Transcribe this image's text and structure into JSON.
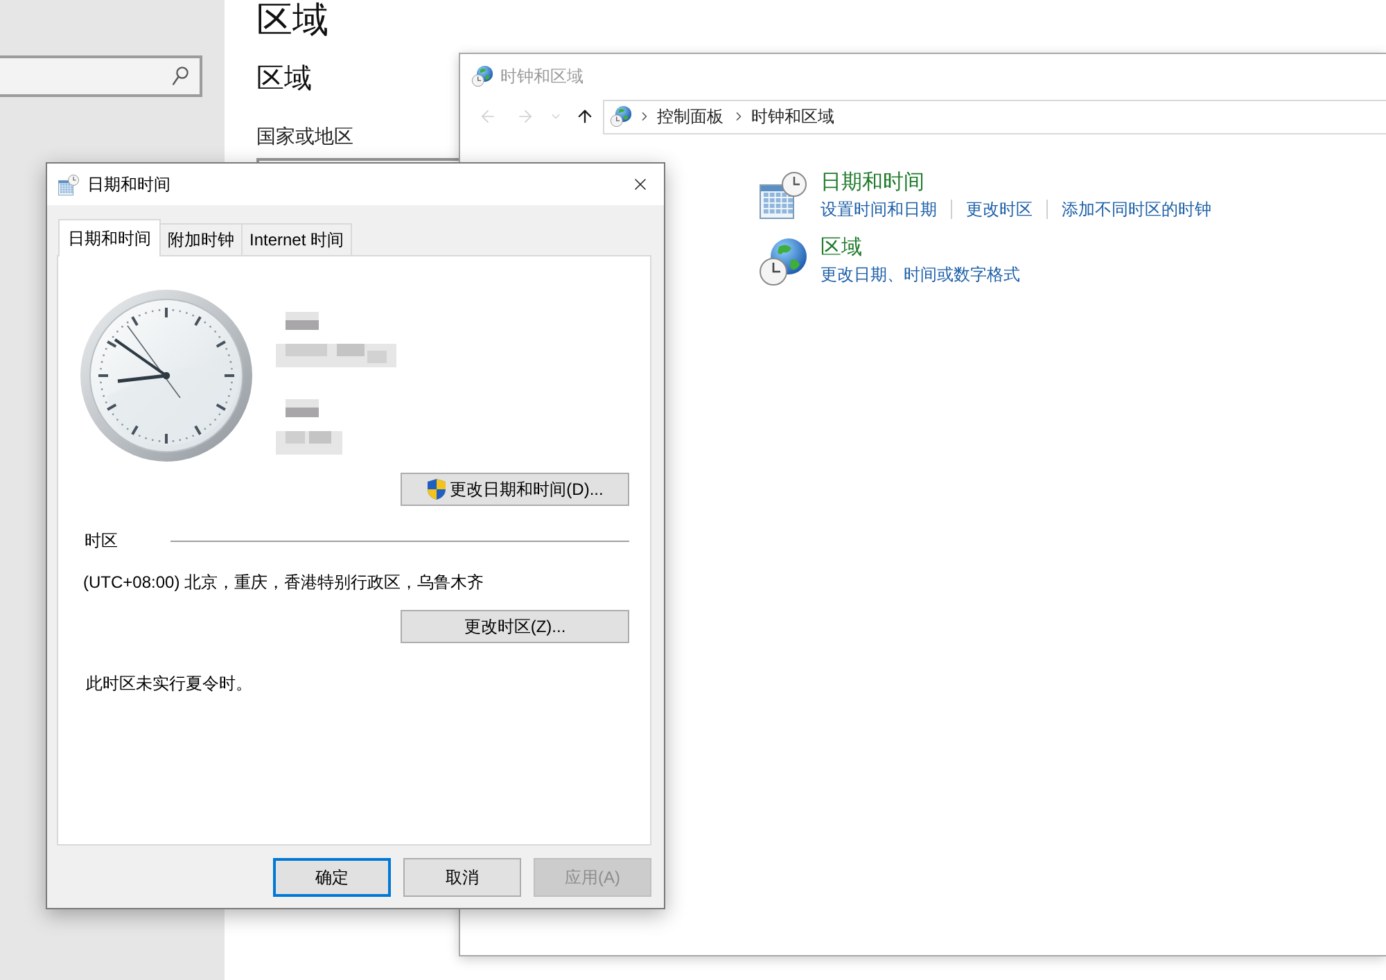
{
  "settings": {
    "page_heading": "区域",
    "section_title": "区域",
    "field_label": "国家或地区"
  },
  "control_panel": {
    "title": "时钟和区域",
    "nav_buttons": [
      {
        "kind": "back",
        "disabled": true
      },
      {
        "kind": "forward",
        "disabled": true
      },
      {
        "kind": "recent",
        "disabled": true
      },
      {
        "kind": "up",
        "disabled": false
      }
    ],
    "breadcrumb": [
      "控制面板",
      "时钟和区域"
    ],
    "categories": [
      {
        "kind": "datetime",
        "title": "日期和时间",
        "links": [
          "设置时间和日期",
          "更改时区",
          "添加不同时区的时钟"
        ]
      },
      {
        "kind": "region",
        "title": "区域",
        "links": [
          "更改日期、时间或数字格式"
        ]
      }
    ]
  },
  "dialog": {
    "title": "日期和时间",
    "tabs": [
      {
        "label": "日期和时间",
        "selected": true
      },
      {
        "label": "附加时钟",
        "selected": false
      },
      {
        "label": "Internet 时间",
        "selected": false
      }
    ],
    "change_datetime_button": "更改日期和时间(D)...",
    "timezone_label": "时区",
    "timezone": "(UTC+08:00) 北京，重庆，香港特别行政区，乌鲁木齐",
    "change_timezone_button": "更改时区(Z)...",
    "dst_note": "此时区未实行夏令时。",
    "buttons": [
      {
        "label": "确定",
        "default": true,
        "disabled": false
      },
      {
        "label": "取消",
        "default": false,
        "disabled": false
      },
      {
        "label": "应用(A)",
        "default": false,
        "disabled": true
      }
    ]
  }
}
